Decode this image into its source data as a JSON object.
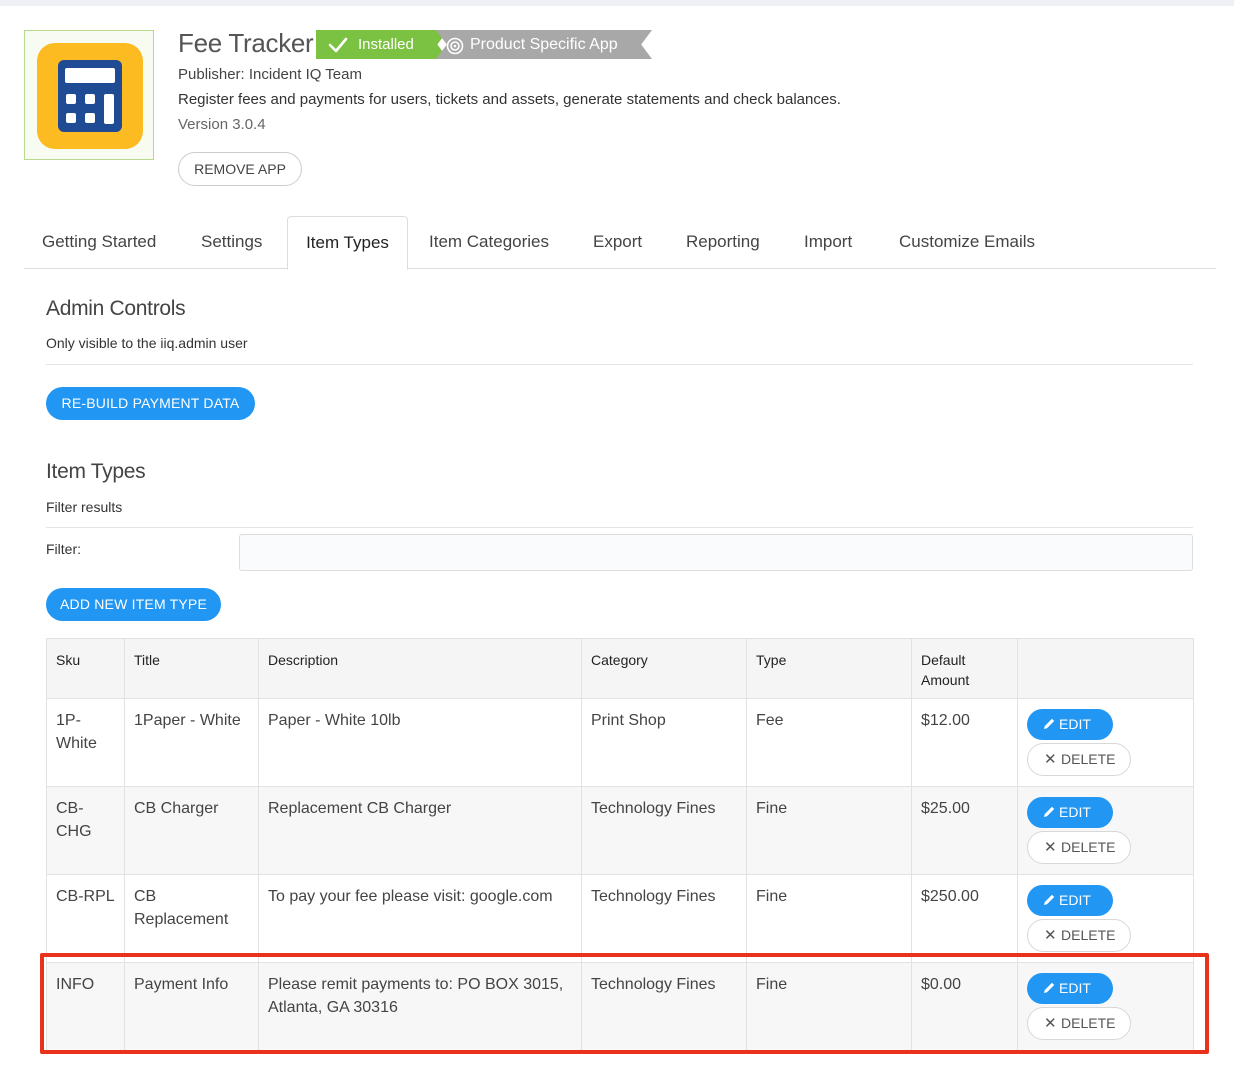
{
  "app": {
    "title": "Fee Tracker",
    "installed_label": "Installed",
    "product_specific_label": "Product Specific App",
    "publisher": "Publisher: Incident IQ Team",
    "description": "Register fees and payments for users, tickets and assets, generate statements and check balances.",
    "version": "Version 3.0.4",
    "remove_label": "REMOVE APP",
    "icon": "calculator-icon",
    "colors": {
      "icon_bg": "#fbbb21",
      "icon_fg": "#1f4b94",
      "installed": "#7cc242",
      "psa": "#a8a8a8"
    }
  },
  "tabs": [
    {
      "label": "Getting Started"
    },
    {
      "label": "Settings"
    },
    {
      "label": "Item Types",
      "active": true
    },
    {
      "label": "Item Categories"
    },
    {
      "label": "Export"
    },
    {
      "label": "Reporting"
    },
    {
      "label": "Import"
    },
    {
      "label": "Customize Emails"
    }
  ],
  "admin": {
    "title": "Admin Controls",
    "subtitle": "Only visible to the iiq.admin user",
    "rebuild_label": "RE-BUILD PAYMENT DATA"
  },
  "item_types": {
    "title": "Item Types",
    "subtitle": "Filter results",
    "filter_label": "Filter:",
    "filter_value": "",
    "add_label": "ADD NEW ITEM TYPE",
    "columns": [
      "Sku",
      "Title",
      "Description",
      "Category",
      "Type",
      "Default Amount",
      ""
    ],
    "rows": [
      {
        "sku": "1P-White",
        "title": "1Paper - White",
        "description": "Paper - White 10lb",
        "category": "Print Shop",
        "type": "Fee",
        "amount": "$12.00"
      },
      {
        "sku": "CB-CHG",
        "title": "CB Charger",
        "description": "Replacement CB Charger",
        "category": "Technology Fines",
        "type": "Fine",
        "amount": "$25.00"
      },
      {
        "sku": "CB-RPL",
        "title": "CB Replacement",
        "description": "To pay your fee please visit: google.com",
        "category": "Technology Fines",
        "type": "Fine",
        "amount": "$250.00"
      },
      {
        "sku": "INFO",
        "title": "Payment Info",
        "description": "Please remit payments to: PO BOX 3015, Atlanta, GA 30316",
        "category": "Technology Fines",
        "type": "Fine",
        "amount": "$0.00"
      }
    ],
    "edit_label": "EDIT",
    "delete_label": "DELETE",
    "highlight_color": "#e8321b",
    "accent_color": "#2196f3"
  }
}
